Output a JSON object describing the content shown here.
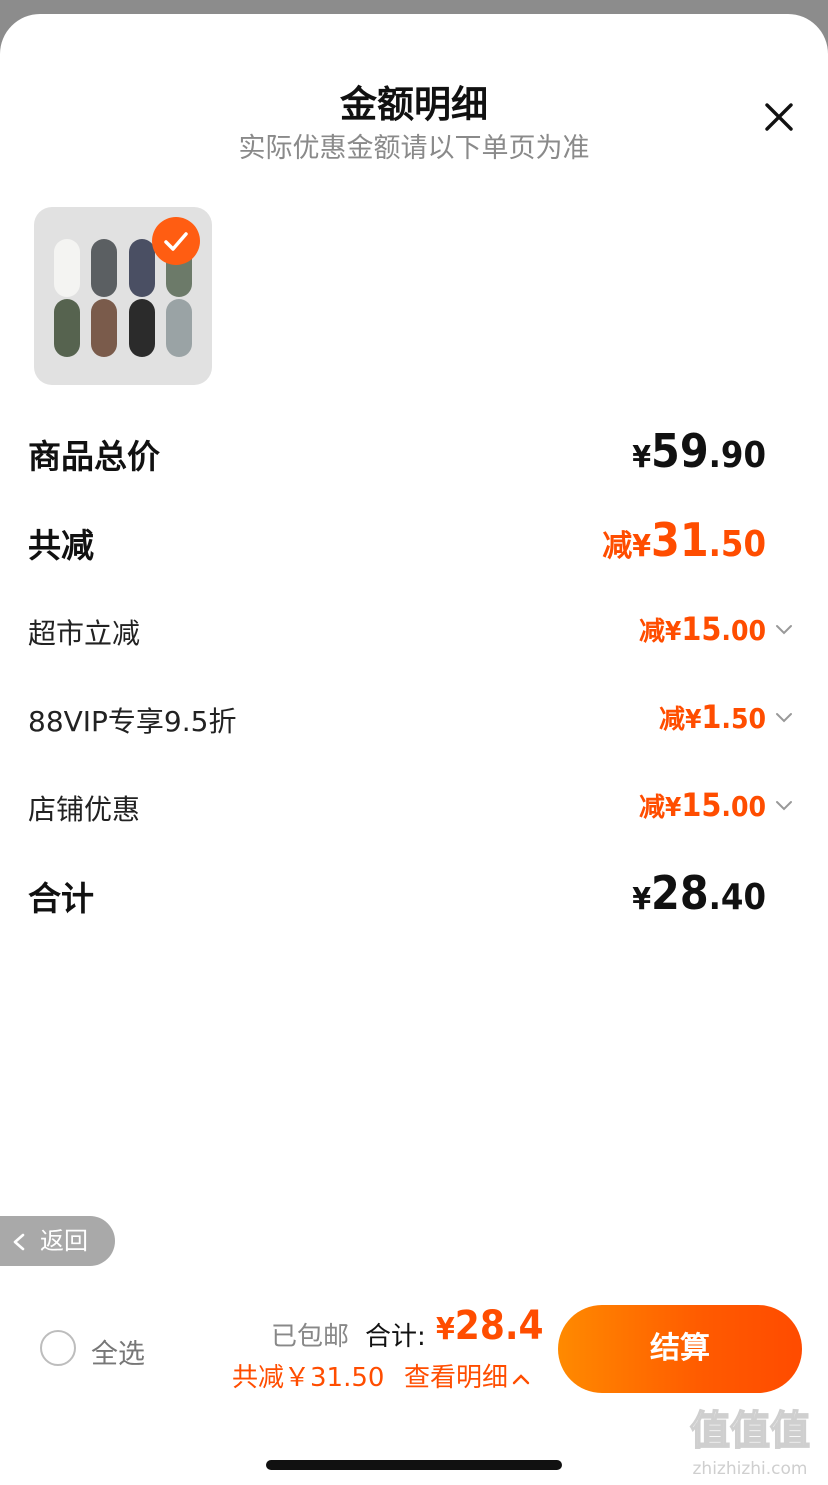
{
  "header": {
    "title": "金额明细",
    "subtitle": "实际优惠金额请以下单页为准",
    "close_icon": "close-icon"
  },
  "product": {
    "thumbnail": "sock-product-image",
    "selected": true
  },
  "rows": {
    "total_price": {
      "label": "商品总价",
      "yen": "¥",
      "int": "59",
      "dec": ".90"
    },
    "total_discount": {
      "label": "共减",
      "prefix": "减",
      "yen": "¥",
      "int": "31",
      "dec": ".50"
    },
    "discounts": [
      {
        "label": "超市立减",
        "prefix": "减",
        "yen": "¥",
        "int": "15",
        "dec": ".00"
      },
      {
        "label": "88VIP专享9.5折",
        "prefix": "减",
        "yen": "¥",
        "int": "1",
        "dec": ".50"
      },
      {
        "label": "店铺优惠",
        "prefix": "减",
        "yen": "¥",
        "int": "15",
        "dec": ".00"
      }
    ],
    "sum": {
      "label": "合计",
      "yen": "¥",
      "int": "28",
      "dec": ".40"
    }
  },
  "back_button": {
    "label": "返回"
  },
  "bottom_bar": {
    "select_all_label": "全选",
    "shipping": "已包邮",
    "total_label": "合计:",
    "total_yen": "¥",
    "total_value": "28.4",
    "discount_text": "共减￥31.50",
    "view_detail": "查看明细",
    "checkout_label": "结算"
  },
  "watermark": {
    "text": "值值值",
    "domain": "zhizhizhi.com"
  },
  "colors": {
    "accent": "#ff4d00",
    "checkout_start": "#ff8a00",
    "checkout_end": "#ff4b00",
    "backdrop": "#8c8c8c"
  }
}
